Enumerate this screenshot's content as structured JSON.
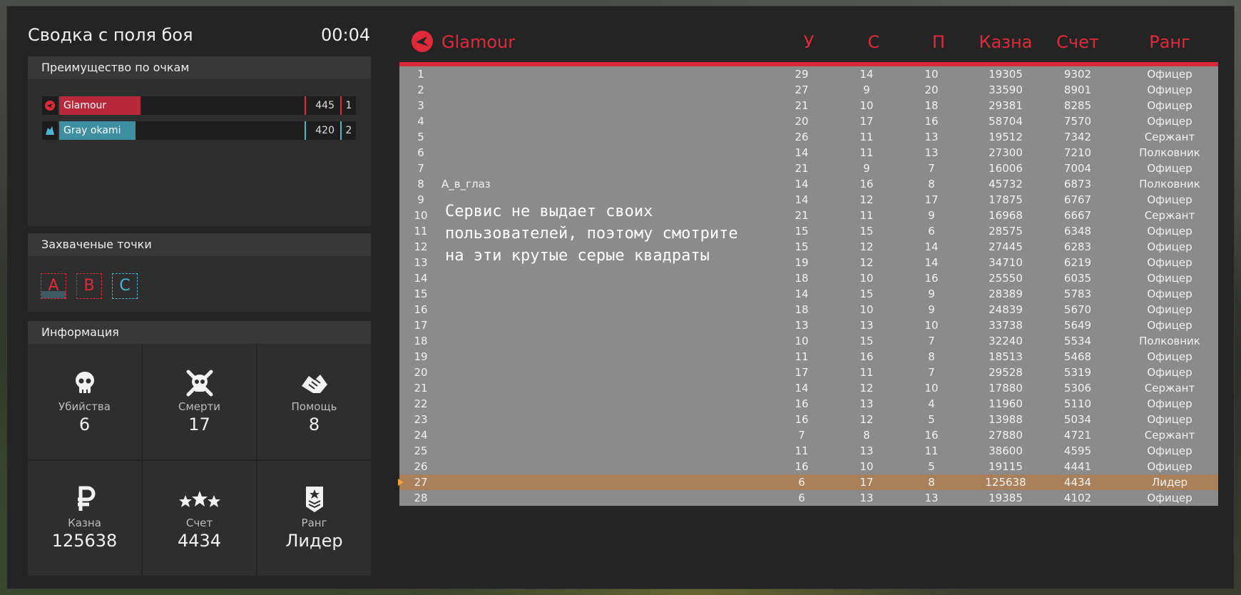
{
  "header": {
    "title": "Сводка с поля боя",
    "timer": "00:04"
  },
  "advantage": {
    "title": "Преимущество по очкам",
    "teams": [
      {
        "name": "Glamour",
        "score": "445",
        "place": "1",
        "color": "#b8283a",
        "accent": "#e02a3a",
        "icon": "eagle-icon",
        "fill_fraction": 0.33
      },
      {
        "name": "Gray okami",
        "score": "420",
        "place": "2",
        "color": "#3f8fa3",
        "accent": "#4bb5cf",
        "icon": "wolf-icon",
        "fill_fraction": 0.31
      }
    ]
  },
  "control_points": {
    "title": "Захваченые точки",
    "points": [
      {
        "label": "A",
        "color": "#e02a3a"
      },
      {
        "label": "B",
        "color": "#e02a3a"
      },
      {
        "label": "C",
        "color": "#4bb5cf"
      }
    ]
  },
  "info": {
    "title": "Информация",
    "stats": [
      {
        "icon": "skull-icon",
        "label": "Убийства",
        "value": "6"
      },
      {
        "icon": "skull-crossbones-icon",
        "label": "Смерти",
        "value": "17"
      },
      {
        "icon": "handshake-icon",
        "label": "Помощь",
        "value": "8"
      },
      {
        "icon": "ruble-icon",
        "label": "Казна",
        "value": "125638"
      },
      {
        "icon": "stars-icon",
        "label": "Счет",
        "value": "4434"
      },
      {
        "icon": "rank-badge-icon",
        "label": "Ранг",
        "value": "Лидер"
      }
    ]
  },
  "scoreboard": {
    "team_name": "Glamour",
    "team_color": "#e02a3a",
    "columns": {
      "kills": "У",
      "deaths": "С",
      "assists": "П",
      "treasury": "Казна",
      "score": "Счет",
      "rank": "Ранг"
    },
    "note": "Сервис не выдает своих пользователей, поэтому смотрите на эти крутые серые квадраты",
    "current_player_row": 27,
    "rows": [
      {
        "n": "1",
        "name": "",
        "k": "29",
        "d": "14",
        "a": "10",
        "t": "19305",
        "s": "9302",
        "r": "Офицер"
      },
      {
        "n": "2",
        "name": "",
        "k": "27",
        "d": "9",
        "a": "20",
        "t": "33590",
        "s": "8901",
        "r": "Офицер"
      },
      {
        "n": "3",
        "name": "",
        "k": "21",
        "d": "10",
        "a": "18",
        "t": "29381",
        "s": "8285",
        "r": "Офицер"
      },
      {
        "n": "4",
        "name": "",
        "k": "20",
        "d": "17",
        "a": "16",
        "t": "58704",
        "s": "7570",
        "r": "Офицер"
      },
      {
        "n": "5",
        "name": "",
        "k": "26",
        "d": "11",
        "a": "13",
        "t": "19512",
        "s": "7342",
        "r": "Сержант"
      },
      {
        "n": "6",
        "name": "",
        "k": "14",
        "d": "11",
        "a": "13",
        "t": "27300",
        "s": "7210",
        "r": "Полковник"
      },
      {
        "n": "7",
        "name": "",
        "k": "21",
        "d": "9",
        "a": "7",
        "t": "16006",
        "s": "7004",
        "r": "Офицер"
      },
      {
        "n": "8",
        "name": "А_в_глаз",
        "k": "14",
        "d": "16",
        "a": "8",
        "t": "45732",
        "s": "6873",
        "r": "Полковник"
      },
      {
        "n": "9",
        "name": "",
        "k": "14",
        "d": "12",
        "a": "17",
        "t": "17875",
        "s": "6767",
        "r": "Офицер"
      },
      {
        "n": "10",
        "name": "",
        "k": "21",
        "d": "11",
        "a": "9",
        "t": "16968",
        "s": "6667",
        "r": "Сержант"
      },
      {
        "n": "11",
        "name": "",
        "k": "15",
        "d": "15",
        "a": "6",
        "t": "28575",
        "s": "6348",
        "r": "Офицер"
      },
      {
        "n": "12",
        "name": "",
        "k": "15",
        "d": "12",
        "a": "14",
        "t": "27445",
        "s": "6283",
        "r": "Офицер"
      },
      {
        "n": "13",
        "name": "",
        "k": "19",
        "d": "12",
        "a": "14",
        "t": "34710",
        "s": "6219",
        "r": "Офицер"
      },
      {
        "n": "14",
        "name": "",
        "k": "18",
        "d": "10",
        "a": "16",
        "t": "25550",
        "s": "6035",
        "r": "Офицер"
      },
      {
        "n": "15",
        "name": "",
        "k": "14",
        "d": "15",
        "a": "9",
        "t": "28389",
        "s": "5783",
        "r": "Офицер"
      },
      {
        "n": "16",
        "name": "",
        "k": "18",
        "d": "10",
        "a": "9",
        "t": "24839",
        "s": "5670",
        "r": "Офицер"
      },
      {
        "n": "17",
        "name": "",
        "k": "13",
        "d": "13",
        "a": "10",
        "t": "33738",
        "s": "5649",
        "r": "Офицер"
      },
      {
        "n": "18",
        "name": "",
        "k": "10",
        "d": "15",
        "a": "7",
        "t": "32240",
        "s": "5534",
        "r": "Полковник"
      },
      {
        "n": "19",
        "name": "",
        "k": "11",
        "d": "16",
        "a": "8",
        "t": "18513",
        "s": "5468",
        "r": "Офицер"
      },
      {
        "n": "20",
        "name": "",
        "k": "17",
        "d": "11",
        "a": "7",
        "t": "29528",
        "s": "5319",
        "r": "Офицер"
      },
      {
        "n": "21",
        "name": "",
        "k": "14",
        "d": "12",
        "a": "10",
        "t": "17880",
        "s": "5306",
        "r": "Сержант"
      },
      {
        "n": "22",
        "name": "",
        "k": "16",
        "d": "13",
        "a": "4",
        "t": "11960",
        "s": "5110",
        "r": "Офицер"
      },
      {
        "n": "23",
        "name": "",
        "k": "16",
        "d": "12",
        "a": "5",
        "t": "13988",
        "s": "5034",
        "r": "Офицер"
      },
      {
        "n": "24",
        "name": "",
        "k": "7",
        "d": "8",
        "a": "16",
        "t": "27880",
        "s": "4721",
        "r": "Сержант"
      },
      {
        "n": "25",
        "name": "",
        "k": "11",
        "d": "13",
        "a": "11",
        "t": "38600",
        "s": "4595",
        "r": "Офицер"
      },
      {
        "n": "26",
        "name": "",
        "k": "16",
        "d": "10",
        "a": "5",
        "t": "19115",
        "s": "4441",
        "r": "Офицер"
      },
      {
        "n": "27",
        "name": "",
        "k": "6",
        "d": "17",
        "a": "8",
        "t": "125638",
        "s": "4434",
        "r": "Лидер"
      },
      {
        "n": "28",
        "name": "",
        "k": "6",
        "d": "13",
        "a": "13",
        "t": "19385",
        "s": "4102",
        "r": "Офицер"
      }
    ]
  }
}
